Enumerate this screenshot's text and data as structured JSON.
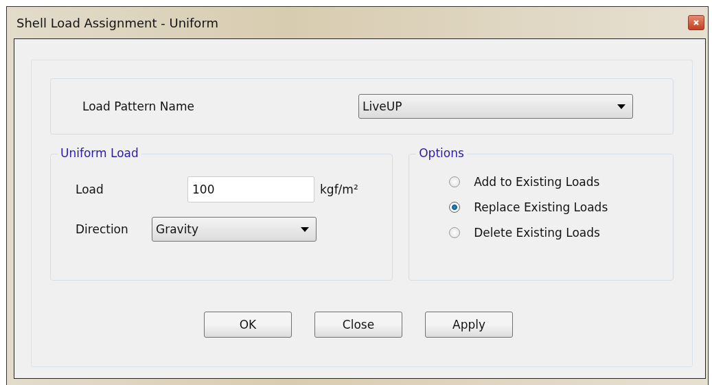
{
  "window": {
    "title": "Shell Load Assignment - Uniform"
  },
  "load_pattern": {
    "label": "Load Pattern Name",
    "value": "LiveUP"
  },
  "uniform_load": {
    "title": "Uniform Load",
    "load_label": "Load",
    "load_value": "100",
    "unit": "kgf/m²",
    "direction_label": "Direction",
    "direction_value": "Gravity"
  },
  "options": {
    "title": "Options",
    "items": [
      {
        "label": "Add to Existing Loads",
        "selected": false
      },
      {
        "label": "Replace Existing Loads",
        "selected": true
      },
      {
        "label": "Delete Existing Loads",
        "selected": false
      }
    ]
  },
  "buttons": [
    "OK",
    "Close",
    "Apply"
  ]
}
